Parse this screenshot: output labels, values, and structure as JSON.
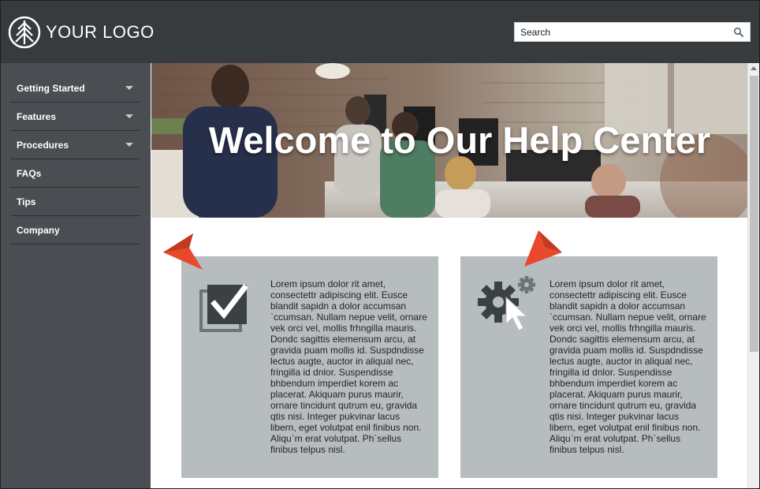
{
  "header": {
    "logo_text": "YOUR LOGO",
    "search": {
      "placeholder": "Search"
    }
  },
  "sidebar": {
    "items": [
      {
        "label": "Getting Started",
        "has_submenu": true
      },
      {
        "label": "Features",
        "has_submenu": true
      },
      {
        "label": "Procedures",
        "has_submenu": true
      },
      {
        "label": "FAQs",
        "has_submenu": false
      },
      {
        "label": "Tips",
        "has_submenu": false
      },
      {
        "label": "Company",
        "has_submenu": false
      }
    ]
  },
  "hero": {
    "title": "Welcome to Our Help Center"
  },
  "cards": [
    {
      "icon": "checkbox-icon",
      "text": "Lorem ipsum dolor rit amet, consectettr adipiscing elit. Eusce blandit sapidn a dolor accumsan `ccumsan. Nullam nepue velit, ornare vek orci vel, mollis frhngilla mauris. Dondc sagittis elemensum arcu, at gravida puam mollis id. Suspdndisse lectus augte, auctor in aliqual nec, fringilla id dnlor. Suspendisse bhbendum imperdiet korem ac placerat. Akiquam purus maurir, ornare tincidunt qutrum eu, gravida qtis nisi. Integer pukvinar lacus libern, eget volutpat enil finibus non. Aliqu`m erat volutpat. Ph`sellus finibus telpus nisl."
    },
    {
      "icon": "settings-cursor-icon",
      "text": "Lorem ipsum dolor rit amet, consectettr adipiscing elit. Eusce blandit sapidn a dolor accumsan `ccumsan. Nullam nepue velit, ornare vek orci vel, mollis frhngilla mauris. Dondc sagittis elemensum arcu, at gravida puam mollis id. Suspdndisse lectus augte, auctor in aliqual nec, fringilla id dnlor. Suspendisse bhbendum imperdiet korem ac placerat. Akiquam purus maurir, ornare tincidunt qutrum eu, gravida qtis nisi. Integer pukvinar lacus libern, eget volutpat enil finibus non. Aliqu`m erat volutpat. Ph`sellus finibus telpus nisl."
    }
  ],
  "colors": {
    "header_bg": "#373b3e",
    "sidebar_bg": "#4a4e52",
    "card_bg": "#b7bcbf",
    "pointer_accent": "#e8492b"
  }
}
